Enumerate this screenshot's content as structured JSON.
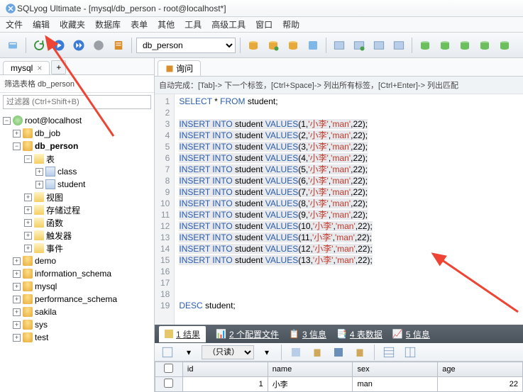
{
  "window_title": "SQLyog Ultimate - [mysql/db_person - root@localhost*]",
  "menubar": [
    "文件",
    "编辑",
    "收藏夹",
    "数据库",
    "表单",
    "其他",
    "工具",
    "高级工具",
    "窗口",
    "帮助"
  ],
  "db_dropdown": "db_person",
  "left_tab": "mysql",
  "filter_label": "筛选表格 db_person",
  "filter_placeholder": "过滤器 (Ctrl+Shift+B)",
  "tree": {
    "root": "root@localhost",
    "dbs": [
      {
        "name": "db_job",
        "expanded": false
      },
      {
        "name": "db_person",
        "expanded": true,
        "bold": true,
        "children": [
          {
            "name": "表",
            "expanded": true,
            "type": "folder",
            "children": [
              {
                "name": "class",
                "type": "table"
              },
              {
                "name": "student",
                "type": "table"
              }
            ]
          },
          {
            "name": "视图",
            "type": "folder"
          },
          {
            "name": "存储过程",
            "type": "folder"
          },
          {
            "name": "函数",
            "type": "folder"
          },
          {
            "name": "触发器",
            "type": "folder"
          },
          {
            "name": "事件",
            "type": "folder"
          }
        ]
      },
      {
        "name": "demo"
      },
      {
        "name": "information_schema"
      },
      {
        "name": "mysql"
      },
      {
        "name": "performance_schema"
      },
      {
        "name": "sakila"
      },
      {
        "name": "sys"
      },
      {
        "name": "test"
      }
    ]
  },
  "query_tab": "询问",
  "autocomplete_hint": "自动完成：[Tab]-> 下一个标签，[Ctrl+Space]-> 列出所有标签，[Ctrl+Enter]-> 列出匹配",
  "sql": {
    "select_kw": "SELECT",
    "from_kw": "FROM",
    "insert_kw": "INSERT INTO",
    "values_kw": "VALUES",
    "desc_kw": "DESC",
    "student": "student",
    "star": " * ",
    "rows": [
      {
        "n": 1,
        "s": "'小李'",
        "g": "'man'",
        "a": 22
      },
      {
        "n": 2,
        "s": "'小李'",
        "g": "'man'",
        "a": 22
      },
      {
        "n": 3,
        "s": "'小李'",
        "g": "'man'",
        "a": 22
      },
      {
        "n": 4,
        "s": "'小李'",
        "g": "'man'",
        "a": 22
      },
      {
        "n": 5,
        "s": "'小李'",
        "g": "'man'",
        "a": 22
      },
      {
        "n": 6,
        "s": "'小李'",
        "g": "'man'",
        "a": 22
      },
      {
        "n": 7,
        "s": "'小李'",
        "g": "'man'",
        "a": 22
      },
      {
        "n": 8,
        "s": "'小李'",
        "g": "'man'",
        "a": 22
      },
      {
        "n": 9,
        "s": "'小李'",
        "g": "'man'",
        "a": 22
      },
      {
        "n": 10,
        "s": "'小李'",
        "g": "'man'",
        "a": 22
      },
      {
        "n": 11,
        "s": "'小李'",
        "g": "'man'",
        "a": 22
      },
      {
        "n": 12,
        "s": "'小李'",
        "g": "'man'",
        "a": 22
      },
      {
        "n": 13,
        "s": "'小李'",
        "g": "'man'",
        "a": 22
      }
    ]
  },
  "result_tabs": {
    "t1": "1 结果",
    "t2": "2 个配置文件",
    "t3": "3 信息",
    "t4": "4 表数据",
    "t5": "5 信息"
  },
  "readonly_label": "（只读）",
  "grid": {
    "cols": [
      "id",
      "name",
      "sex",
      "age"
    ],
    "rows": [
      {
        "id": "1",
        "name": "小李",
        "sex": "man",
        "age": "22"
      }
    ]
  }
}
